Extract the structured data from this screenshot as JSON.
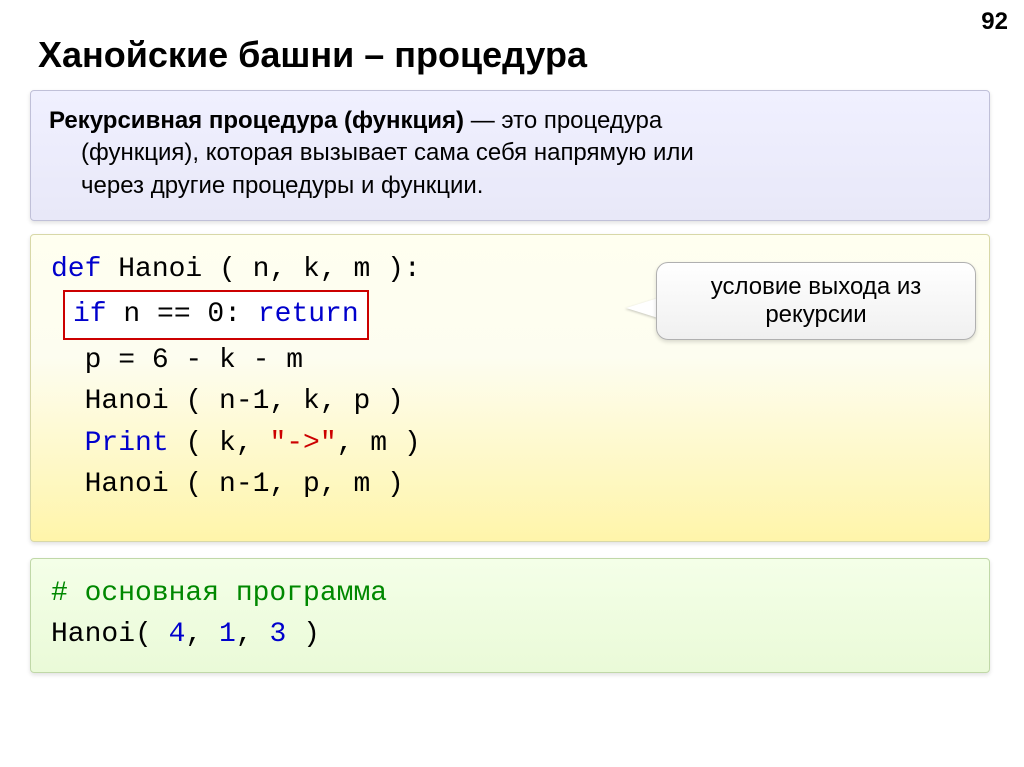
{
  "page_number": "92",
  "title": "Ханойские башни – процедура",
  "definition": {
    "term": "Рекурсивная процедура (функция)",
    "dash": " — ",
    "body1": "это процедура",
    "body2": "(функция), которая вызывает сама себя напрямую или",
    "body3": "через другие процедуры и функции."
  },
  "code": {
    "def_kw": "def",
    "def_rest": " Hanoi ( n, k, m ):",
    "if_kw": "if",
    "if_cond": " n == 0: ",
    "return_kw": "return",
    "line_p": "  p = 6 - k - m",
    "line_call1": "  Hanoi ( n-1, k, p )",
    "print_kw": "Print",
    "print_pre": " ( k, ",
    "print_str": "\"->\"",
    "print_post": ", m )",
    "line_call2": "  Hanoi ( n-1, p, m )"
  },
  "callout": "условие выхода из рекурсии",
  "main": {
    "comment": "# основная программа",
    "call_name": "Hanoi( ",
    "a1": "4",
    "sep1": ", ",
    "a2": "1",
    "sep2": ", ",
    "a3": "3",
    "close": " )"
  }
}
